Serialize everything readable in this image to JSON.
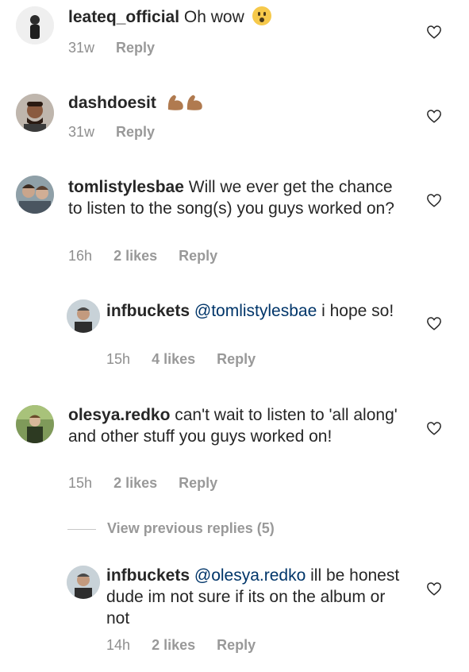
{
  "comments": [
    {
      "user": "leateq_official",
      "text": "Oh wow",
      "emoji": "astonished-face-emoji",
      "time": "31w",
      "likes": "",
      "reply": "Reply"
    },
    {
      "user": "dashdoesit",
      "text": "",
      "emoji": "flexed-biceps-emoji",
      "time": "31w",
      "likes": "",
      "reply": "Reply"
    },
    {
      "user": "tomlistylesbae",
      "text": "Will we ever get the chance to listen to the song(s) you guys worked on?",
      "time": "16h",
      "likes": "2 likes",
      "reply": "Reply"
    },
    {
      "user": "infbuckets",
      "mention": "@tomlistylesbae",
      "text": "i hope so!",
      "time": "15h",
      "likes": "4 likes",
      "reply": "Reply"
    },
    {
      "user": "olesya.redko",
      "text": "can't wait to listen to 'all along' and other stuff you guys worked on!",
      "time": "15h",
      "likes": "2 likes",
      "reply": "Reply"
    },
    {
      "user": "infbuckets",
      "mention": "@olesya.redko",
      "text": "ill be honest dude im not sure if its on the album or not",
      "time": "14h",
      "likes": "2 likes",
      "reply": "Reply"
    }
  ],
  "view_previous": "View previous replies (5)",
  "icons": {
    "like": "heart-outline-icon"
  },
  "colors": {
    "text": "#262626",
    "meta": "#8e8e8e",
    "mention": "#003569"
  }
}
